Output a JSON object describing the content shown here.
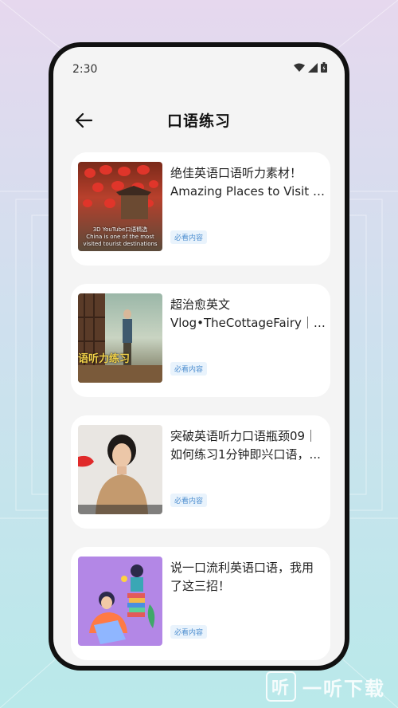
{
  "status_bar": {
    "time": "2:30"
  },
  "header": {
    "title": "口语练习"
  },
  "cards": [
    {
      "title_line1": "绝佳英语口语听力素材！",
      "title_line2": "Amazing Places to Visit in ...",
      "tag": "必看内容",
      "thumb_caption_1": "3D   YouTube口语精选",
      "thumb_caption_2": "China is one of the most",
      "thumb_caption_3": "visited tourist destinations"
    },
    {
      "title_line1": "超治愈英文",
      "title_line2": "Vlog•TheCottageFairy｜英...",
      "tag": "必看内容",
      "thumb_caption": "语听力练习"
    },
    {
      "title_line1": "突破英语听力口语瓶颈09｜",
      "title_line2": "如何练习1分钟即兴口语，...",
      "tag": "必看内容"
    },
    {
      "title_line1": "说一口流利英语口语，我用",
      "title_line2": "了这三招！",
      "tag": "必看内容"
    }
  ],
  "watermark": {
    "text": "一听下载",
    "logo": "听"
  }
}
